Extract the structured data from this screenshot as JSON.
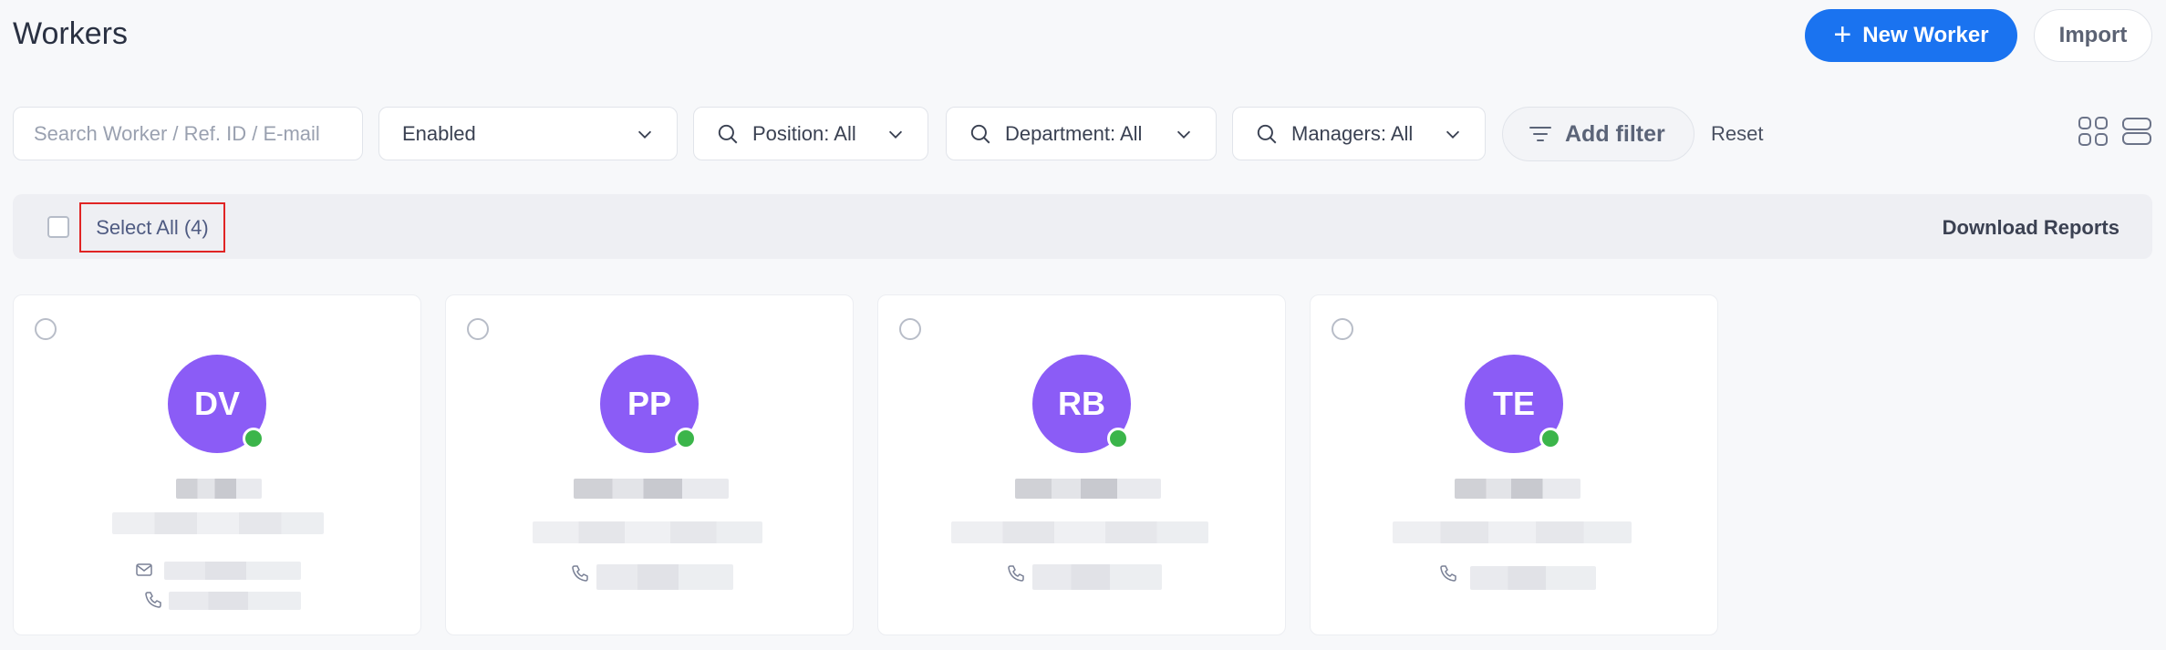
{
  "page": {
    "title": "Workers"
  },
  "header": {
    "new_worker_label": "New Worker",
    "import_label": "Import"
  },
  "filters": {
    "search_placeholder": "Search Worker / Ref. ID / E-mail",
    "status_value": "Enabled",
    "position_label": "Position: All",
    "department_label": "Department: All",
    "managers_label": "Managers: All",
    "add_filter_label": "Add filter",
    "reset_label": "Reset"
  },
  "selection_bar": {
    "select_all_label": "Select All (4)",
    "download_reports_label": "Download Reports"
  },
  "workers": [
    {
      "initials": "DV",
      "status": "online"
    },
    {
      "initials": "PP",
      "status": "online"
    },
    {
      "initials": "RB",
      "status": "online"
    },
    {
      "initials": "TE",
      "status": "online"
    }
  ],
  "colors": {
    "accent": "#1a73f0",
    "avatar": "#8b5cf6",
    "online": "#3bb54a",
    "highlight_border": "#e02424"
  }
}
